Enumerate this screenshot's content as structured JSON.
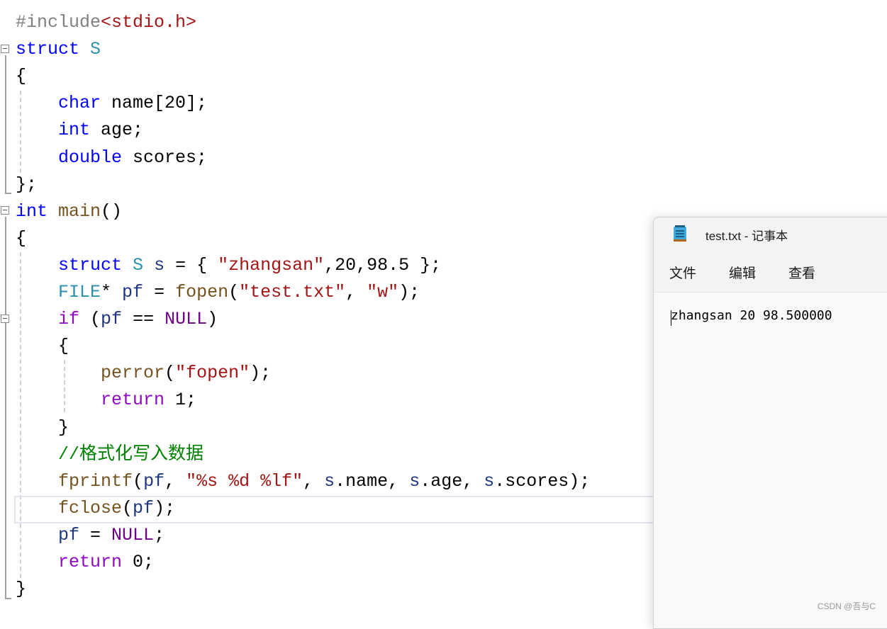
{
  "editor": {
    "lines": [
      [
        [
          "pp",
          "#include"
        ],
        [
          "str",
          "<stdio.h>"
        ]
      ],
      [
        [
          "kw",
          "struct"
        ],
        [
          "pl",
          " "
        ],
        [
          "ty",
          "S"
        ]
      ],
      [
        [
          "pl",
          "{"
        ]
      ],
      [
        [
          "pl",
          "    "
        ],
        [
          "kw",
          "char"
        ],
        [
          "pl",
          " name[20];"
        ]
      ],
      [
        [
          "pl",
          "    "
        ],
        [
          "kw",
          "int"
        ],
        [
          "pl",
          " age;"
        ]
      ],
      [
        [
          "pl",
          "    "
        ],
        [
          "kw",
          "double"
        ],
        [
          "pl",
          " scores;"
        ]
      ],
      [
        [
          "pl",
          "};"
        ]
      ],
      [
        [
          "kw",
          "int"
        ],
        [
          "pl",
          " "
        ],
        [
          "fn",
          "main"
        ],
        [
          "pl",
          "()"
        ]
      ],
      [
        [
          "pl",
          "{"
        ]
      ],
      [
        [
          "pl",
          "    "
        ],
        [
          "kw",
          "struct"
        ],
        [
          "pl",
          " "
        ],
        [
          "ty",
          "S"
        ],
        [
          "pl",
          " "
        ],
        [
          "var",
          "s"
        ],
        [
          "pl",
          " = { "
        ],
        [
          "str",
          "\"zhangsan\""
        ],
        [
          "pl",
          ",20,98.5 };"
        ]
      ],
      [
        [
          "pl",
          "    "
        ],
        [
          "ty",
          "FILE"
        ],
        [
          "pl",
          "* "
        ],
        [
          "var",
          "pf"
        ],
        [
          "pl",
          " = "
        ],
        [
          "fn",
          "fopen"
        ],
        [
          "pl",
          "("
        ],
        [
          "str",
          "\"test.txt\""
        ],
        [
          "pl",
          ", "
        ],
        [
          "str",
          "\"w\""
        ],
        [
          "pl",
          ");"
        ]
      ],
      [
        [
          "pl",
          "    "
        ],
        [
          "ctl",
          "if"
        ],
        [
          "pl",
          " ("
        ],
        [
          "var",
          "pf"
        ],
        [
          "pl",
          " == "
        ],
        [
          "mac",
          "NULL"
        ],
        [
          "pl",
          ")"
        ]
      ],
      [
        [
          "pl",
          "    {"
        ]
      ],
      [
        [
          "pl",
          "        "
        ],
        [
          "fn",
          "perror"
        ],
        [
          "pl",
          "("
        ],
        [
          "str",
          "\"fopen\""
        ],
        [
          "pl",
          ");"
        ]
      ],
      [
        [
          "pl",
          "        "
        ],
        [
          "ctl",
          "return"
        ],
        [
          "pl",
          " 1;"
        ]
      ],
      [
        [
          "pl",
          "    }"
        ]
      ],
      [
        [
          "pl",
          "    "
        ],
        [
          "cm",
          "//格式化写入数据"
        ]
      ],
      [
        [
          "pl",
          "    "
        ],
        [
          "fn",
          "fprintf"
        ],
        [
          "pl",
          "("
        ],
        [
          "var",
          "pf"
        ],
        [
          "pl",
          ", "
        ],
        [
          "str",
          "\"%s %d %lf\""
        ],
        [
          "pl",
          ", "
        ],
        [
          "var",
          "s"
        ],
        [
          "pl",
          ".name, "
        ],
        [
          "var",
          "s"
        ],
        [
          "pl",
          ".age, "
        ],
        [
          "var",
          "s"
        ],
        [
          "pl",
          ".scores);"
        ]
      ],
      [
        [
          "pl",
          "    "
        ],
        [
          "fn",
          "fclose"
        ],
        [
          "pl",
          "("
        ],
        [
          "var",
          "pf"
        ],
        [
          "pl",
          ");"
        ]
      ],
      [
        [
          "pl",
          "    "
        ],
        [
          "var",
          "pf"
        ],
        [
          "pl",
          " = "
        ],
        [
          "mac",
          "NULL"
        ],
        [
          "pl",
          ";"
        ]
      ],
      [
        [
          "pl",
          "    "
        ],
        [
          "ctl",
          "return"
        ],
        [
          "pl",
          " 0;"
        ]
      ],
      [
        [
          "pl",
          "}"
        ]
      ]
    ]
  },
  "notepad": {
    "title": "test.txt - 记事本",
    "icon": "notepad-icon",
    "menu": [
      "文件",
      "编辑",
      "查看"
    ],
    "content": "zhangsan 20 98.500000"
  },
  "watermark": "CSDN @吾与C"
}
